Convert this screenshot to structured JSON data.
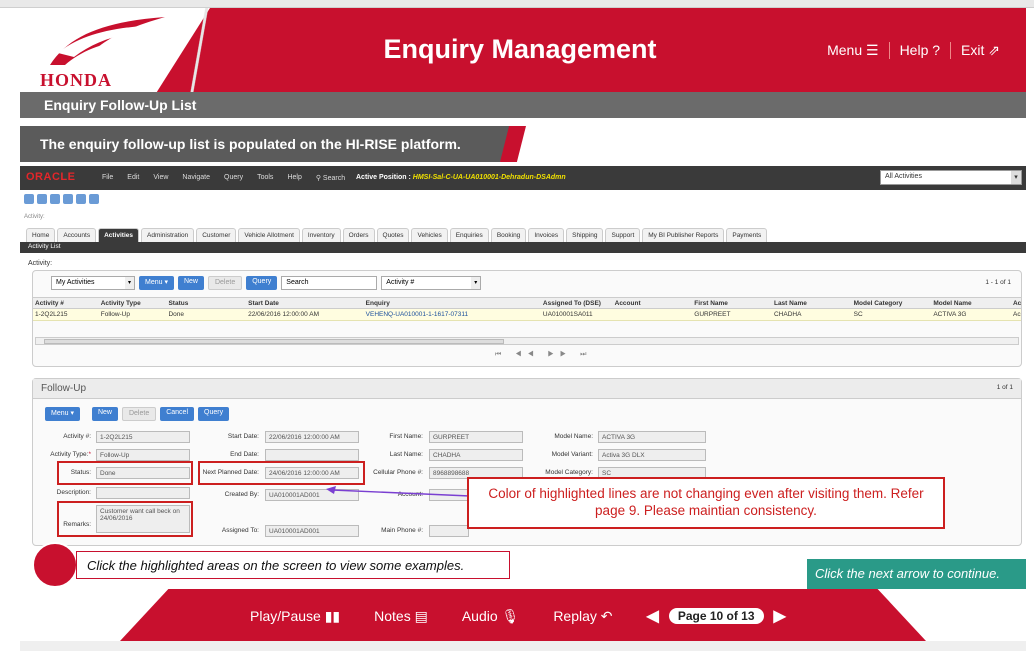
{
  "header": {
    "brand": "HONDA",
    "title": "Enquiry Management",
    "menu": "Menu ☰",
    "help": "Help ?",
    "exit": "Exit ⇗"
  },
  "subheader": "Enquiry Follow-Up List",
  "banner": "The enquiry follow-up list is populated on the HI-RISE platform.",
  "oracle": {
    "logo": "ORACLE",
    "menus": [
      "File",
      "Edit",
      "View",
      "Navigate",
      "Query",
      "Tools",
      "Help",
      "⚲ Search"
    ],
    "active_position_label": "Active Position :",
    "active_position_value": "HMSI-Sal-C-UA-UA010001-Dehradun-DSAdmn",
    "all_activities": "All Activities",
    "crumb": "Activity:",
    "tabs": [
      "Home",
      "Accounts",
      "Activities",
      "Administration",
      "Customer",
      "Vehicle Allotment",
      "Inventory",
      "Orders",
      "Quotes",
      "Vehicles",
      "Enquiries",
      "Booking",
      "Invoices",
      "Shipping",
      "Support",
      "My BI Publisher Reports",
      "Payments"
    ],
    "active_tab": "Activities",
    "activity_list": "Activity List",
    "activity_label": "Activity:",
    "list_toolbar": {
      "view": "My Activities",
      "menu": "Menu ▾",
      "new": "New",
      "delete": "Delete",
      "query": "Query",
      "search": "Search",
      "field": "Activity #",
      "pager": "1 - 1 of 1"
    },
    "grid_headers": [
      "Activity #",
      "Activity Type",
      "Status",
      "Start Date",
      "Enquiry",
      "Assigned To (DSE)",
      "Account",
      "First Name",
      "Last Name",
      "Model Category",
      "Model Name",
      "Ac"
    ],
    "grid_row": [
      "1-2Q2L215",
      "Follow-Up",
      "Done",
      "22/06/2016 12:00:00 AM",
      "VEHENQ-UA010001-1-1617-07311",
      "UA010001SA011",
      "",
      "GURPREET",
      "CHADHA",
      "SC",
      "ACTIVA 3G",
      "Ac"
    ],
    "followup": {
      "title": "Follow-Up",
      "pager": "1 of 1",
      "buttons": {
        "menu": "Menu ▾",
        "new": "New",
        "delete": "Delete",
        "cancel": "Cancel",
        "query": "Query"
      },
      "labels": {
        "activity_no": "Activity #:",
        "activity_type": "Activity Type:",
        "status": "Status:",
        "description": "Description:",
        "remarks": "Remarks:",
        "start_date": "Start Date:",
        "end_date": "End Date:",
        "next_planned": "Next Planned Date:",
        "created_by": "Created By:",
        "assigned_to": "Assigned To:",
        "first_name": "First Name:",
        "last_name": "Last Name:",
        "cell_phone": "Cellular Phone #:",
        "account": "Account:",
        "main_phone": "Main Phone #:",
        "model_name": "Model Name:",
        "model_variant": "Model Variant:",
        "model_category": "Model Category:"
      },
      "values": {
        "activity_no": "1-2Q2L215",
        "activity_type": "Follow-Up",
        "status": "Done",
        "description": "",
        "remarks": "Customer want call beck on 24/06/2016",
        "start_date": "22/06/2016 12:00:00 AM",
        "end_date": "",
        "next_planned": "24/06/2016 12:00:00 AM",
        "created_by": "UA010001AD001",
        "assigned_to": "UA010001AD001",
        "first_name": "GURPREET",
        "last_name": "CHADHA",
        "cell_phone": "8968898688",
        "account": "",
        "main_phone": "",
        "model_name": "ACTIVA 3G",
        "model_variant": "Activa 3G DLX",
        "model_category": "SC"
      }
    }
  },
  "callout": "Color of highlighted lines are not changing even after visiting them. Refer page 9. Please maintian consistency.",
  "hint": "Click the highlighted areas on the screen to view some examples.",
  "next_hint": "Click the next arrow to continue.",
  "footer": {
    "play_pause": "Play/Pause ▮▮",
    "notes": "Notes ▤",
    "audio": "Audio 🎙",
    "replay": "Replay ↶",
    "page": "Page 10 of 13"
  },
  "colors": {
    "brand_red": "#c8102e",
    "teal": "#2a9a88",
    "highlight_row": "#fffde0"
  }
}
